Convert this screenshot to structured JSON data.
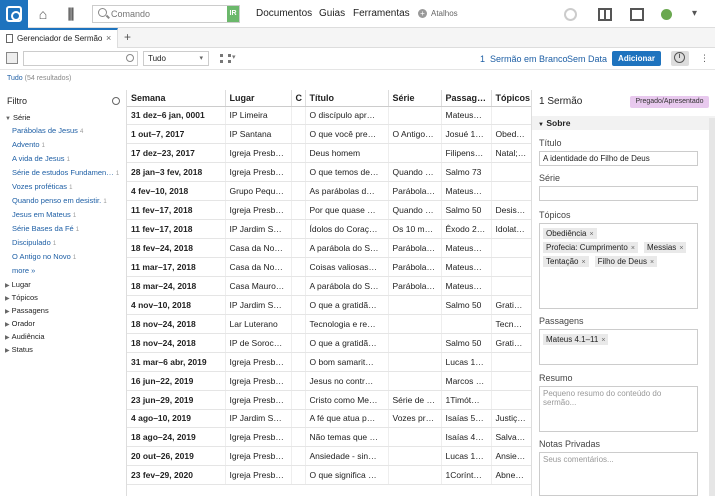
{
  "topbar": {
    "command_placeholder": "Comando",
    "command_badge": "IR",
    "menu": [
      "Documentos",
      "Guias",
      "Ferramentas"
    ],
    "shortcuts": "Atalhos"
  },
  "tab": {
    "title": "Gerenciador de Sermão",
    "new_tab": "+"
  },
  "toolbar": {
    "filter_select": "Tudo",
    "count": "1",
    "blank_sermon": "Sermão em Branco",
    "no_date": "Sem Data",
    "add_label": "Adicionar",
    "info": "i"
  },
  "results": {
    "label": "Tudo",
    "count": "(54 resultados)"
  },
  "filter": {
    "title": "Filtro",
    "serie_label": "Série",
    "serie_items": [
      {
        "label": "Parábolas de Jesus",
        "count": "4"
      },
      {
        "label": "Advento",
        "count": "1"
      },
      {
        "label": "A vida de Jesus",
        "count": "1"
      },
      {
        "label": "Série de estudos Fundamen…",
        "count": "1"
      },
      {
        "label": "Vozes proféticas",
        "count": "1"
      },
      {
        "label": "Quando penso em desistir.",
        "count": "1"
      },
      {
        "label": "Jesus em Mateus",
        "count": "1"
      },
      {
        "label": "Série Bases da Fé",
        "count": "1"
      },
      {
        "label": "Discipulado",
        "count": "1"
      },
      {
        "label": "O Antigo no Novo",
        "count": "1"
      }
    ],
    "more": "more »",
    "groups": [
      "Lugar",
      "Tópicos",
      "Passagens",
      "Orador",
      "Audiência",
      "Status"
    ]
  },
  "table": {
    "headers": [
      "Semana",
      "Lugar",
      "C",
      "Título",
      "Série",
      "Passag…",
      "Tópicos"
    ],
    "rows": [
      [
        "31 dez–6 jan, 0001",
        "IP Limeira",
        "",
        "O discípulo apr…",
        "",
        "Mateus…",
        ""
      ],
      [
        "1 out–7, 2017",
        "IP Santana",
        "",
        "O que você pre…",
        "O Antigo…",
        "Josué 1…",
        "Obedec…"
      ],
      [
        "17 dez–23, 2017",
        "Igreja Presb…",
        "",
        "Deus homem",
        "",
        "Filipens…",
        "Natal; J…"
      ],
      [
        "28 jan–3 fev, 2018",
        "Igreja Presb…",
        "",
        "O que temos de…",
        "Quando …",
        "Salmo 73",
        ""
      ],
      [
        "4 fev–10, 2018",
        "Grupo Pequ…",
        "",
        "As parábolas d…",
        "Parábola…",
        "Mateus…",
        ""
      ],
      [
        "11 fev–17, 2018",
        "Igreja Presb…",
        "",
        "Por que quase …",
        "Quando …",
        "Salmo 50",
        "Desistir…"
      ],
      [
        "11 fev–17, 2018",
        "IP Jardim S…",
        "",
        "Ídolos do Coraç…",
        "Os 10 m…",
        "Êxodo 2…",
        "Idolatri…"
      ],
      [
        "18 fev–24, 2018",
        "Casa da No…",
        "",
        "A parábola do S…",
        "Parábola…",
        "Mateus…",
        ""
      ],
      [
        "11 mar–17, 2018",
        "Casa da No…",
        "",
        "Coisas valiosas…",
        "Parábola…",
        "Mateus…",
        ""
      ],
      [
        "18 mar–24, 2018",
        "Casa Mauro…",
        "",
        "A parábola do S…",
        "Parábola…",
        "Mateus…",
        ""
      ],
      [
        "4 nov–10, 2018",
        "IP Jardim S…",
        "",
        "O que a gratidã…",
        "",
        "Salmo 50",
        "Gratidã…"
      ],
      [
        "18 nov–24, 2018",
        "Lar Luterano",
        "",
        "Tecnologia e re…",
        "",
        "",
        "Tecnol…"
      ],
      [
        "18 nov–24, 2018",
        "IP de Soroc…",
        "",
        "O que a gratidã…",
        "",
        "Salmo 50",
        "Gratidã…"
      ],
      [
        "31 mar–6 abr, 2019",
        "Igreja Presb…",
        "",
        "O bom samarit…",
        "",
        "Lucas 1…",
        ""
      ],
      [
        "16 jun–22, 2019",
        "Igreja Presb…",
        "",
        "Jesus no contr…",
        "",
        "Marcos …",
        ""
      ],
      [
        "23 jun–29, 2019",
        "Igreja Presb…",
        "",
        "Cristo como Me…",
        "Série de …",
        "1Timót…",
        ""
      ],
      [
        "4 ago–10, 2019",
        "IP Jardim S…",
        "",
        "A fé que atua p…",
        "Vozes pr…",
        "Isaías 5…",
        "Justiça;…"
      ],
      [
        "18 ago–24, 2019",
        "Igreja Presb…",
        "",
        "Não temas que …",
        "",
        "Isaías 4…",
        "Salvaçã…"
      ],
      [
        "20 out–26, 2019",
        "Igreja Presb…",
        "",
        "Ansiedade - sin…",
        "",
        "Lucas 1…",
        "Ansieda…"
      ],
      [
        "23 fev–29, 2020",
        "Igreja Presb…",
        "",
        "O que significa …",
        "",
        "1Corínt…",
        "Abnega…"
      ]
    ]
  },
  "detail": {
    "title": "1 Sermão",
    "status_badge": "Pregado/Apresentado",
    "section": "Sobre",
    "titulo_label": "Título",
    "titulo_value": "A identidade do Filho de Deus",
    "serie_label": "Série",
    "topicos_label": "Tópicos",
    "topicos": [
      "Obediência",
      "Profecia: Cumprimento",
      "Messias",
      "Tentação",
      "Filho de Deus"
    ],
    "passagens_label": "Passagens",
    "passagens": [
      "Mateus 4.1–11"
    ],
    "resumo_label": "Resumo",
    "resumo_placeholder": "Pequeno resumo do conteúdo do sermão...",
    "notas_label": "Notas Privadas",
    "notas_placeholder": "Seus comentários..."
  },
  "colors": {
    "accent": "#1e73be",
    "badge": "#e8c9ee",
    "link": "#1e5fa5"
  }
}
